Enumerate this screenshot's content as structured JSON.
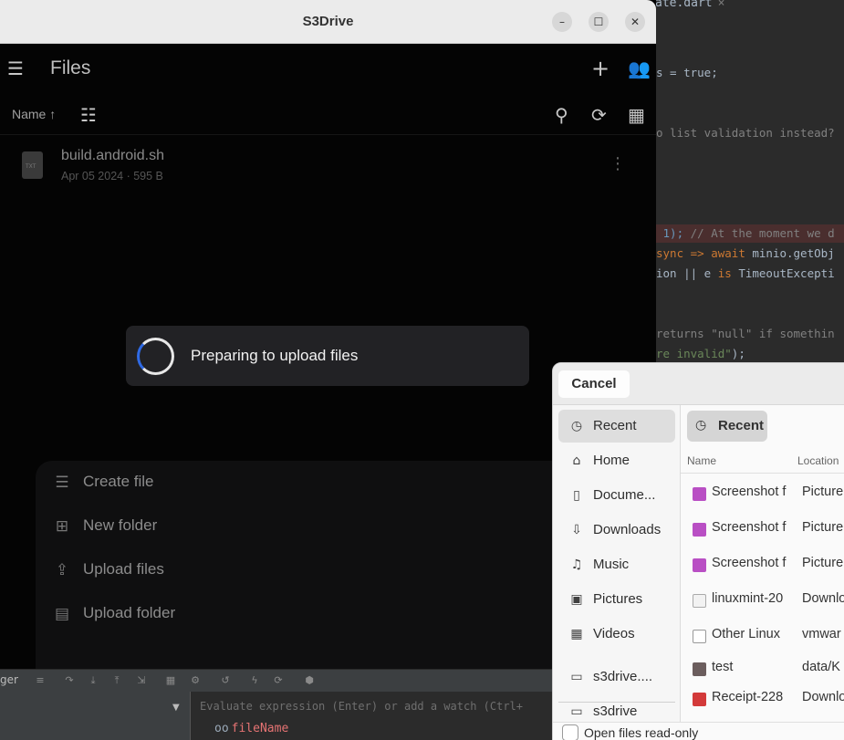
{
  "ide": {
    "tab_name": "ate.dart",
    "tab_close": "×",
    "code_lines": [
      {
        "segments": [
          {
            "t": "s = true;",
            "c": ""
          }
        ]
      },
      {
        "segments": [
          {
            "t": "o list validation instead?",
            "c": "cm"
          }
        ]
      },
      {
        "segments": [
          {
            "t": " 1); ",
            "c": "nm"
          },
          {
            "t": "// At the moment we d",
            "c": "cm"
          }
        ]
      },
      {
        "segments": [
          {
            "t": "sync => ",
            "c": "kw"
          },
          {
            "t": "await ",
            "c": "kw"
          },
          {
            "t": "minio.getObj",
            "c": ""
          }
        ]
      },
      {
        "segments": [
          {
            "t": "ion || e ",
            "c": ""
          },
          {
            "t": "is ",
            "c": "kw"
          },
          {
            "t": "TimeoutExcepti",
            "c": ""
          }
        ]
      },
      {
        "segments": [
          {
            "t": "returns \"null\" if somethin",
            "c": "cm"
          }
        ]
      },
      {
        "segments": [
          {
            "t": "re invalid\"",
            "c": "st"
          },
          {
            "t": ");",
            "c": ""
          }
        ]
      }
    ],
    "debugger_label": "ger",
    "eval_placeholder": "Evaluate expression (Enter) or add a watch (Ctrl+",
    "watch_glyph": "oo",
    "watch_var": "fileName"
  },
  "app": {
    "window_title": "S3Drive",
    "win_buttons": {
      "minimize": "–",
      "maximize": "☐",
      "close": "✕"
    },
    "page_title": "Files",
    "sort_label": "Name ↑",
    "file": {
      "name": "build.android.sh",
      "meta": "Apr 05 2024 · 595 B",
      "badge": "TXT"
    },
    "toast_text": "Preparing to upload files",
    "sheet_items": [
      {
        "label": "Create file",
        "icon": "short-text-icon",
        "glyph": "☰"
      },
      {
        "label": "New folder",
        "icon": "new-folder-icon",
        "glyph": "⊞"
      },
      {
        "label": "Upload files",
        "icon": "upload-file-icon",
        "glyph": "⇪"
      },
      {
        "label": "Upload folder",
        "icon": "folder-icon",
        "glyph": "▤"
      }
    ],
    "accent": "#2f6ae5"
  },
  "dialog": {
    "cancel_label": "Cancel",
    "places": [
      {
        "label": "Recent",
        "icon": "clock-icon",
        "glyph": "◷",
        "active": true
      },
      {
        "label": "Home",
        "icon": "home-icon",
        "glyph": "⌂"
      },
      {
        "label": "Docume...",
        "icon": "document-icon",
        "glyph": "▯"
      },
      {
        "label": "Downloads",
        "icon": "download-icon",
        "glyph": "⇩"
      },
      {
        "label": "Music",
        "icon": "music-icon",
        "glyph": "♫"
      },
      {
        "label": "Pictures",
        "icon": "image-icon",
        "glyph": "▣"
      },
      {
        "label": "Videos",
        "icon": "video-icon",
        "glyph": "▦"
      },
      {
        "label": "s3drive....",
        "icon": "drive-icon",
        "glyph": "▭"
      },
      {
        "label": "s3drive",
        "icon": "drive-icon",
        "glyph": "▭"
      }
    ],
    "location_chip": "Recent",
    "columns": {
      "name": "Name",
      "location": "Location"
    },
    "files": [
      {
        "name": "Screenshot f",
        "location": "Picture",
        "type": "image"
      },
      {
        "name": "Screenshot f",
        "location": "Picture",
        "type": "image"
      },
      {
        "name": "Screenshot f",
        "location": "Picture",
        "type": "image"
      },
      {
        "name": "linuxmint-20",
        "location": "Downlo",
        "type": "disc"
      },
      {
        "name": "Other Linux",
        "location": "vmwar",
        "type": "doc"
      },
      {
        "name": "test",
        "location": "data/K",
        "type": "folder"
      },
      {
        "name": "Receipt-228",
        "location": "Downlo",
        "type": "pdf"
      }
    ],
    "read_only_label": "Open files read-only"
  }
}
